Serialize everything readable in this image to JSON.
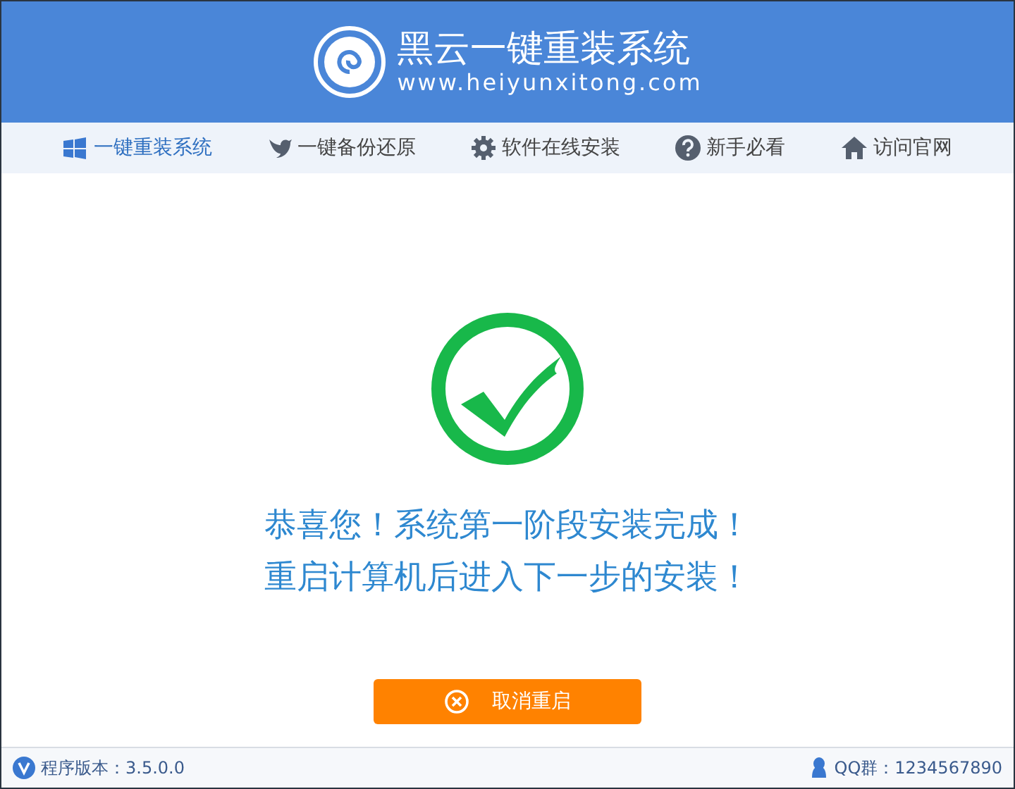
{
  "header": {
    "title": "黑云一键重装系统",
    "url": "www.heiyunxitong.com"
  },
  "nav": [
    {
      "label": "一键重装系统",
      "kind": "windows",
      "selected": true
    },
    {
      "label": "一键备份还原",
      "kind": "bird",
      "selected": false
    },
    {
      "label": "软件在线安装",
      "kind": "gear",
      "selected": false
    },
    {
      "label": "新手必看",
      "kind": "question",
      "selected": false
    },
    {
      "label": "访问官网",
      "kind": "home",
      "selected": false
    }
  ],
  "message": [
    "恭喜您！系统第一阶段安装完成！",
    "重启计算机后进入下一步的安装！"
  ],
  "cancel_button": {
    "label": "取消重启"
  },
  "footer": {
    "version": "程序版本：3.5.0.0",
    "qq": "QQ群：1234567890"
  }
}
